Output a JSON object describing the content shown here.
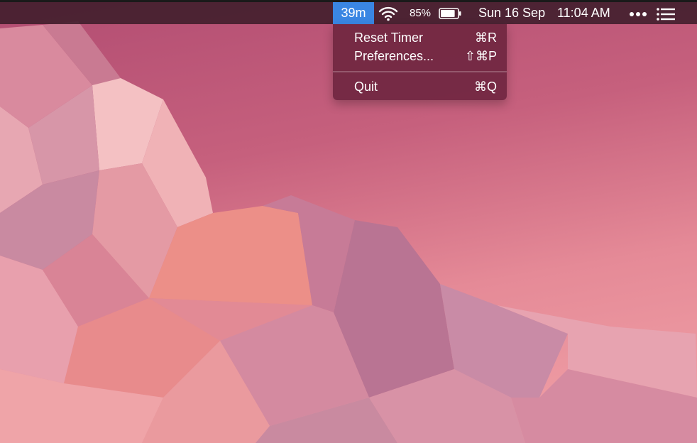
{
  "menubar": {
    "timer_label": "39m",
    "battery_percent": "85%",
    "battery_level": 0.85,
    "date": "Sun 16 Sep",
    "time": "11:04 AM",
    "highlight_color": "#3a86e3"
  },
  "menu": {
    "items": [
      {
        "label": "Reset Timer",
        "shortcut": "⌘R"
      },
      {
        "label": "Preferences...",
        "shortcut": "⇧⌘P"
      },
      {
        "label": "Quit",
        "shortcut": "⌘Q"
      }
    ]
  },
  "icons": {
    "wifi": "wifi-icon",
    "battery": "battery-icon",
    "more": "ellipsis-icon",
    "list": "list-icon"
  }
}
